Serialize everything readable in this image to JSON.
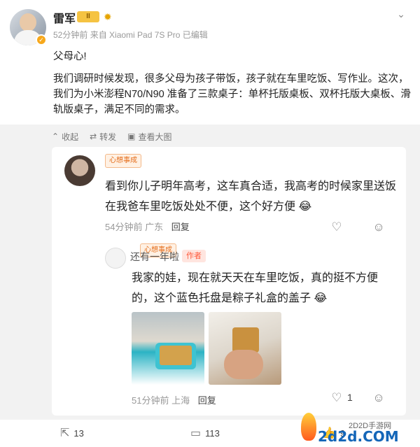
{
  "post": {
    "author": "雷军",
    "level_badge": "II",
    "time": "52分钟前",
    "source": "来自 Xiaomi Pad 7S Pro",
    "edited": "已编辑",
    "text1": "父母心!",
    "text2": "我们调研时候发现，很多父母为孩子带饭，孩子就在车里吃饭、写作业。这次，我们为小米澎程N70/N90 准备了三款桌子：单杯托版桌板、双杯托版大桌板、滑轨版桌子，满足不同的需求。",
    "actions": [
      "收起",
      "转发",
      "查看大图"
    ]
  },
  "comment": {
    "badge": "心想事成",
    "text": "看到你儿子明年高考，这车真合适，我高考的时候家里送饭在我爸车里吃饭处处不便，这个好方便",
    "time": "54分钟前",
    "location": "广东",
    "reply_label": "回复"
  },
  "reply": {
    "badge": "心想事成",
    "name": "还有一年啦",
    "author_tag": "作者",
    "text": "我家的娃，现在就天天在车里吃饭，真的挺不方便的，这个蓝色托盘是粽子礼盒的盖子",
    "time": "51分钟前",
    "location": "上海",
    "reply_label": "回复",
    "likes": "1"
  },
  "bottom": {
    "shares": "13",
    "comments": "113",
    "likes": "9"
  },
  "watermark": {
    "small": "2D2D手游网",
    "big": "2d2d.COM"
  },
  "icons": {
    "more": "chevron-down-icon",
    "collect": "star-icon",
    "repost": "repost-icon",
    "view": "image-icon",
    "like": "heart-icon",
    "emoji": "smile-icon",
    "share": "share-icon",
    "comment": "comment-icon"
  },
  "colors": {
    "author_tag_bg": "#ffe5df",
    "author_tag_text": "#ff5a3c",
    "vip": "#f7a81b"
  }
}
